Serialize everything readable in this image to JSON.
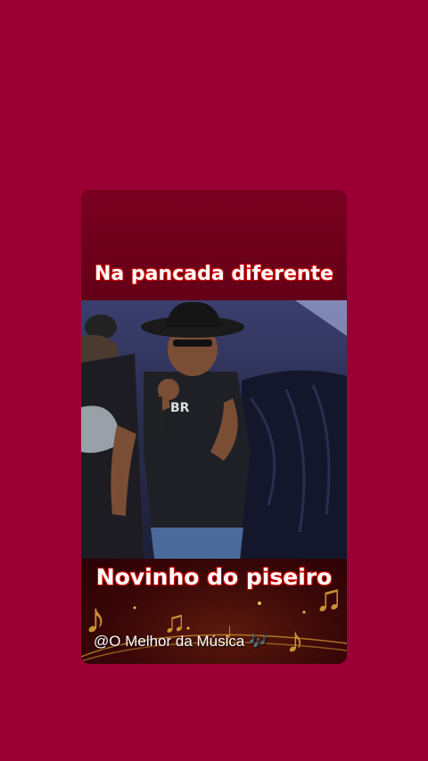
{
  "post": {
    "top_caption": "Na pancada diferente",
    "bottom_caption": "Novinho do piseiro",
    "watermark": "@O Melhor da Música 🎶"
  },
  "icons": {
    "decoration": "music-notes-icon"
  },
  "colors": {
    "background": "#9a0033",
    "caption_text": "#ffffff",
    "caption_outline": "#cc0000"
  }
}
